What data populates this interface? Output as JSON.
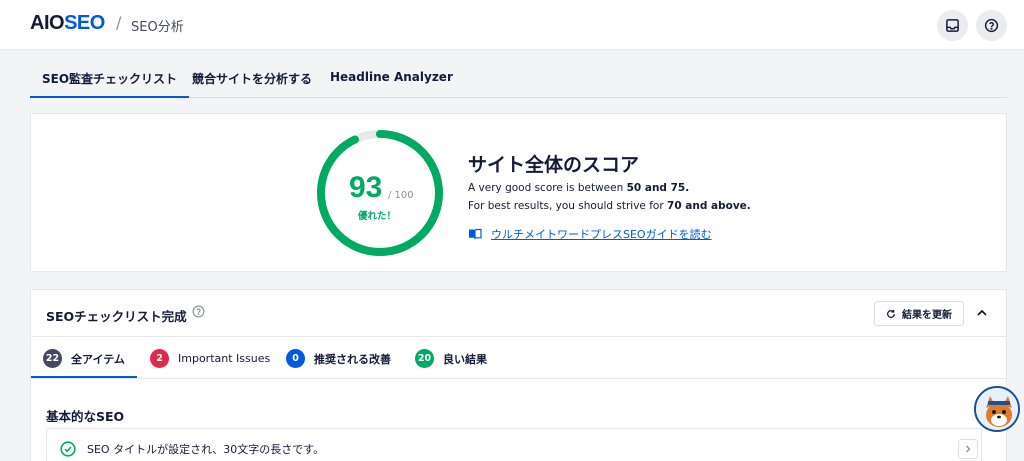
{
  "header": {
    "logo_main": "AIO",
    "logo_accent": "SEO",
    "separator": "/",
    "breadcrumb": "SEO分析",
    "buttons": [
      {
        "icon": "inbox-icon"
      },
      {
        "icon": "help-circle-icon"
      }
    ]
  },
  "tabs": [
    {
      "label": "SEO監査チェックリスト",
      "active": true
    },
    {
      "label": "競合サイトを分析する",
      "active": false
    },
    {
      "label": "Headline Analyzer",
      "active": false
    }
  ],
  "score": {
    "value": "93",
    "max": "/ 100",
    "fraction": 0.93,
    "verdict": "優れた！",
    "title": "サイト全体のスコア",
    "line1_prefix": "A very good score is between ",
    "line1_bold": "50 and 75.",
    "line2_prefix": "For best results, you should strive for ",
    "line2_bold": "70 and above.",
    "guide_link": "ウルチメイトワードプレスSEOガイドを読む",
    "color": "#00aa63",
    "track_color": "#e8e8eb"
  },
  "checklist": {
    "title": "SEOチェックリスト完成",
    "refresh_label": "結果を更新",
    "filters": [
      {
        "count": "22",
        "label": "全アイテム",
        "color": "#434960",
        "active": true
      },
      {
        "count": "2",
        "label": "Important Issues",
        "color": "#df2a4a",
        "active": false
      },
      {
        "count": "0",
        "label": "推奨される改善",
        "color": "#005ae0",
        "active": false
      },
      {
        "count": "20",
        "label": "良い結果",
        "color": "#00aa63",
        "active": false
      }
    ],
    "section_title": "基本的なSEO",
    "items": [
      {
        "text": "SEO タイトルが設定され、30文字の長さです。",
        "status": "pass"
      }
    ]
  },
  "colors": {
    "accent": "#005ae0",
    "good": "#00aa63",
    "important": "#df2a4a"
  }
}
